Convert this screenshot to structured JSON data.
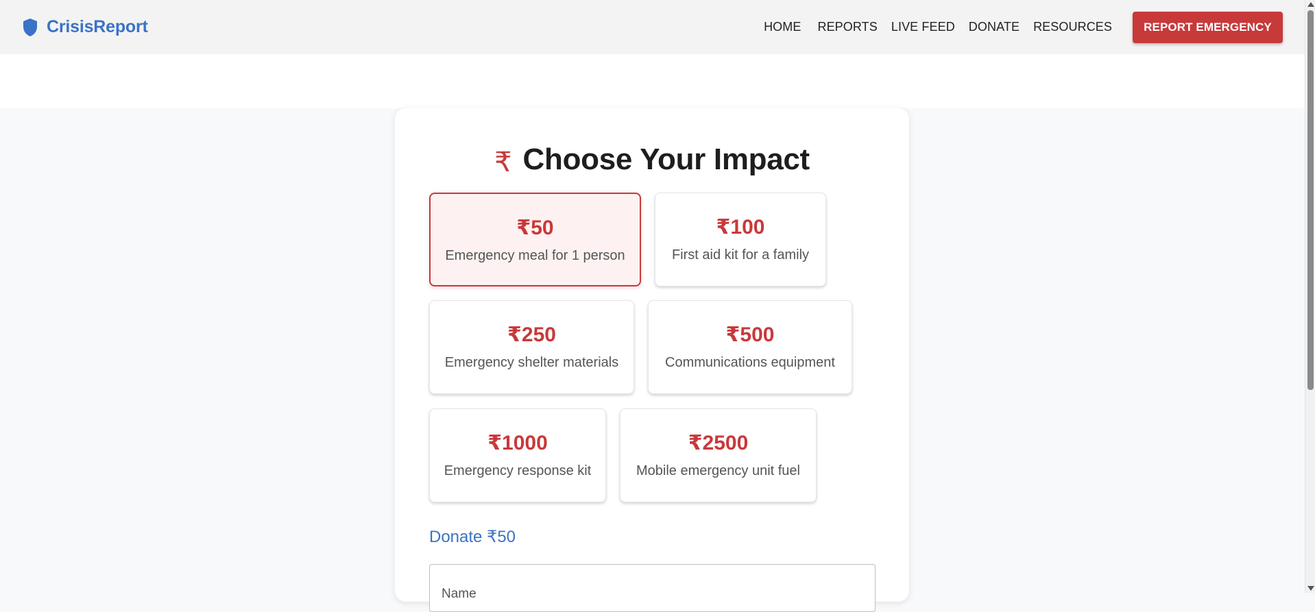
{
  "brand": {
    "name": "CrisisReport",
    "icon": "shield-icon",
    "color": "#3a73c6"
  },
  "nav": {
    "items": [
      {
        "label": "HOME"
      },
      {
        "label": "REPORTS"
      },
      {
        "label": "LIVE FEED"
      },
      {
        "label": "DONATE"
      },
      {
        "label": "RESOURCES"
      }
    ],
    "cta_label": "REPORT EMERGENCY",
    "cta_color": "#c8393a"
  },
  "impact": {
    "icon": "rupee-icon",
    "icon_glyph": "₹",
    "title": "Choose Your Impact",
    "selected_index": 0,
    "options": [
      {
        "amount": "₹50",
        "description": "Emergency meal for 1 person"
      },
      {
        "amount": "₹100",
        "description": "First aid kit for a family"
      },
      {
        "amount": "₹250",
        "description": "Emergency shelter materials"
      },
      {
        "amount": "₹500",
        "description": "Communications equipment"
      },
      {
        "amount": "₹1000",
        "description": "Emergency response kit"
      },
      {
        "amount": "₹2500",
        "description": "Mobile emergency unit fuel"
      }
    ],
    "donate_label": "Donate ₹50",
    "name_placeholder": "Name"
  },
  "colors": {
    "accent": "#c8393a",
    "link": "#3a73c6",
    "selected_bg": "#fdf1f1"
  }
}
